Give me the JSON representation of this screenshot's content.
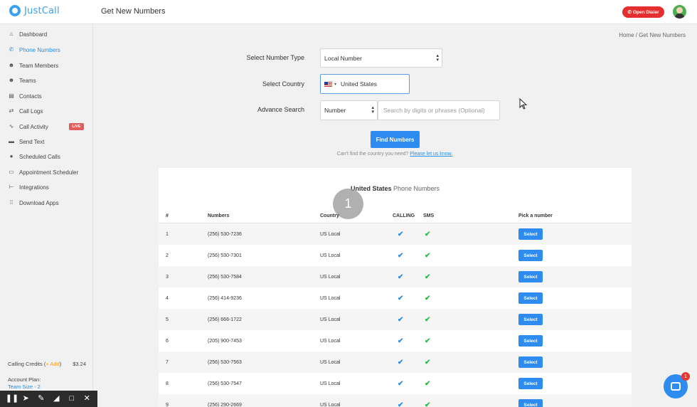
{
  "app": {
    "logo_text": "JustCall",
    "page_title": "Get New Numbers",
    "open_dialer": "Open Dialer"
  },
  "sidebar": {
    "items": [
      {
        "label": "Dashboard",
        "icon": "home-icon",
        "active": false
      },
      {
        "label": "Phone Numbers",
        "icon": "phone-icon",
        "active": true
      },
      {
        "label": "Team Members",
        "icon": "users-icon",
        "active": false
      },
      {
        "label": "Teams",
        "icon": "group-icon",
        "active": false
      },
      {
        "label": "Contacts",
        "icon": "contact-card-icon",
        "active": false
      },
      {
        "label": "Call Logs",
        "icon": "logs-icon",
        "active": false
      },
      {
        "label": "Call Activity",
        "icon": "activity-icon",
        "active": false,
        "badge": "LIVE"
      },
      {
        "label": "Send Text",
        "icon": "message-icon",
        "active": false
      },
      {
        "label": "Scheduled Calls",
        "icon": "clock-icon",
        "active": false
      },
      {
        "label": "Appointment Scheduler",
        "icon": "calendar-icon",
        "active": false
      },
      {
        "label": "Integrations",
        "icon": "plug-icon",
        "active": false
      },
      {
        "label": "Download Apps",
        "icon": "grid-icon",
        "active": false
      }
    ],
    "credits_label": "Calling Credits (",
    "credits_add": "+ Add",
    "credits_close": ")",
    "credits_amount": "$3.24",
    "plan_label": "Account Plan:",
    "team_size": "Team Size - 2"
  },
  "breadcrumb": "Home / Get New Numbers",
  "form": {
    "number_type_label": "Select Number Type",
    "number_type_value": "Local Number",
    "country_label": "Select Country",
    "country_value": "United States",
    "advance_label": "Advance Search",
    "search_type_value": "Number",
    "search_placeholder": "Search by digits or phrases (Optional)",
    "find_button": "Find Numbers",
    "cant_find_text": "Can't find the country you need? ",
    "cant_find_link": "Please let us know."
  },
  "results": {
    "title_bold": "United States",
    "title_rest": " Phone Numbers",
    "step_marker": "1",
    "headers": {
      "num": "#",
      "numbers": "Numbers",
      "country": "Country",
      "calling": "CALLING",
      "sms": "SMS",
      "pick": "Pick a number"
    },
    "select_label": "Select",
    "rows": [
      {
        "n": "1",
        "number": "(256) 530-7236",
        "country": "US Local"
      },
      {
        "n": "2",
        "number": "(256) 530-7301",
        "country": "US Local"
      },
      {
        "n": "3",
        "number": "(256) 530-7584",
        "country": "US Local"
      },
      {
        "n": "4",
        "number": "(256) 414-9236",
        "country": "US Local"
      },
      {
        "n": "5",
        "number": "(256) 666-1722",
        "country": "US Local"
      },
      {
        "n": "6",
        "number": "(205) 900-7453",
        "country": "US Local"
      },
      {
        "n": "7",
        "number": "(256) 530-7563",
        "country": "US Local"
      },
      {
        "n": "8",
        "number": "(256) 530-7547",
        "country": "US Local"
      },
      {
        "n": "9",
        "number": "(256) 290-2669",
        "country": "US Local"
      }
    ]
  },
  "chat": {
    "badge": "1"
  },
  "colors": {
    "brand": "#3aa0f0",
    "primary": "#2e8cf0",
    "danger": "#e52f2f",
    "check_calling": "#2a8ee2",
    "check_sms": "#2db84d"
  }
}
